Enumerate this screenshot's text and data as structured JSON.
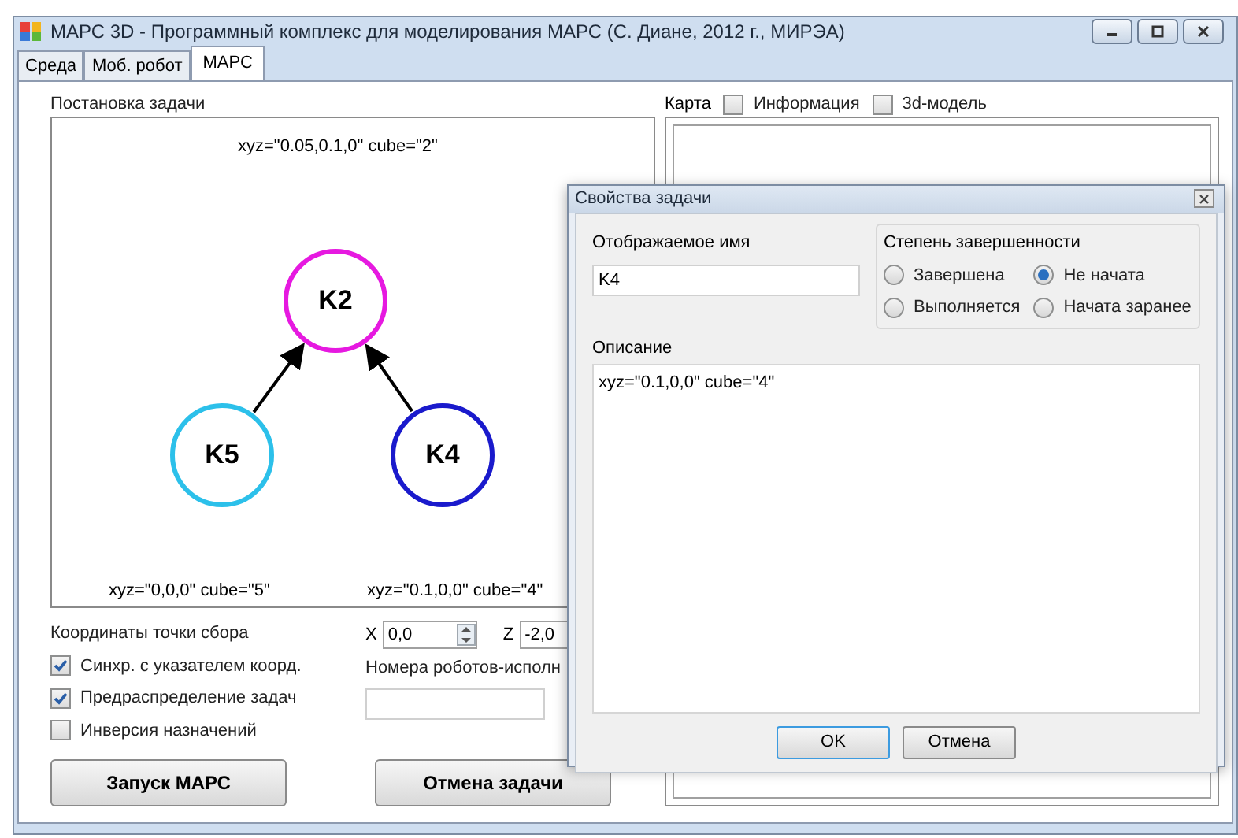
{
  "window": {
    "title": "МАРС 3D - Программный комплекс для моделирования МАРС (С. Диане, 2012 г., МИРЭА)"
  },
  "tabs": [
    {
      "label": "Среда",
      "selected": false
    },
    {
      "label": "Моб. робот",
      "selected": false
    },
    {
      "label": "МАРС",
      "selected": true
    }
  ],
  "task_panel": {
    "label": "Постановка задачи",
    "graph": {
      "root": {
        "label": "K2",
        "color": "#e619e0",
        "caption": "xyz=\"0.05,0.1,0\" cube=\"2\"",
        "children": [
          {
            "label": "K5",
            "color": "#2cc0ea",
            "caption": "xyz=\"0,0,0\" cube=\"5\""
          },
          {
            "label": "K4",
            "color": "#1a1acc",
            "caption": "xyz=\"0.1,0,0\" cube=\"4\""
          }
        ]
      }
    }
  },
  "assembly": {
    "label": "Координаты точки сбора",
    "checkboxes": [
      {
        "label": "Синхр. с указателем коорд.",
        "checked": true
      },
      {
        "label": "Предраспределение задач",
        "checked": true
      },
      {
        "label": "Инверсия назначений",
        "checked": false
      }
    ],
    "x": {
      "label": "X",
      "value": "0,0"
    },
    "z": {
      "label": "Z",
      "value": "-2,0"
    },
    "robots_label": "Номера роботов-исполн",
    "buttons": [
      "Запуск МАРС",
      "Отмена задачи"
    ]
  },
  "map_panel": {
    "label": "Карта",
    "checkboxes": [
      {
        "label": "Информация",
        "checked": false
      },
      {
        "label": "3d-модель",
        "checked": false
      }
    ]
  },
  "dialog": {
    "title": "Свойства задачи",
    "name_label": "Отображаемое имя",
    "name_value": "K4",
    "status_label": "Степень завершенности",
    "status_options": [
      {
        "label": "Завершена",
        "selected": false
      },
      {
        "label": "Не начата",
        "selected": true
      },
      {
        "label": "Выполняется",
        "selected": false
      },
      {
        "label": "Начата заранее",
        "selected": false
      }
    ],
    "description_label": "Описание",
    "description_value": "xyz=\"0.1,0,0\" cube=\"4\"",
    "buttons": [
      "OK",
      "Отмена"
    ]
  }
}
